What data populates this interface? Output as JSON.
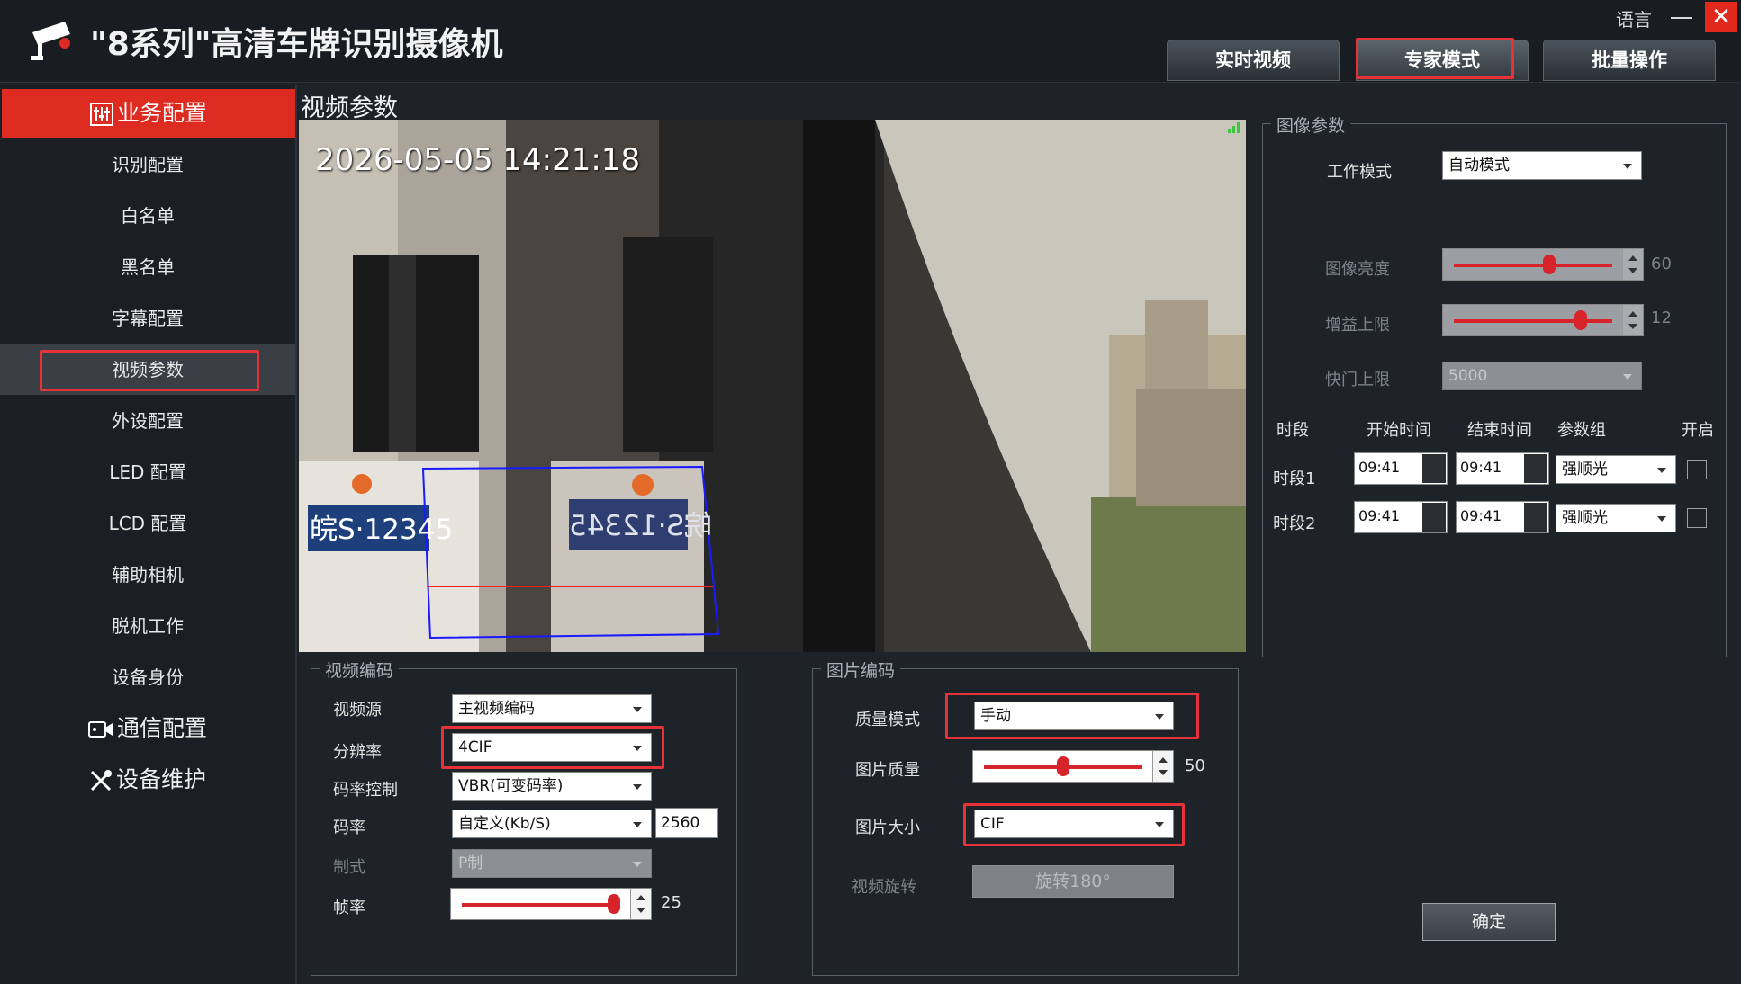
{
  "app": {
    "title": "\"8系列\"高清车牌识别摄像机",
    "language": "语言",
    "close_glyph": "✕"
  },
  "top_tabs": [
    {
      "label": "实时视频"
    },
    {
      "label": "专家模式"
    },
    {
      "label": "批量操作"
    }
  ],
  "sidebar": {
    "business_section": "业务配置",
    "items": [
      "识别配置",
      "白名单",
      "黑名单",
      "字幕配置",
      "视频参数",
      "外设配置",
      "LED 配置",
      "LCD 配置",
      "辅助相机",
      "脱机工作",
      "设备身份"
    ],
    "active_item": "视频参数",
    "comm_section": "通信配置",
    "maint_section": "设备维护"
  },
  "main": {
    "title": "视频参数",
    "video": {
      "timestamp": "2026-05-05 14:21:18",
      "plate_left": "皖S·12345",
      "plate_right": "皖S·12345"
    }
  },
  "video_encoding": {
    "legend": "视频编码",
    "source_label": "视频源",
    "source_value": "主视频编码",
    "resolution_label": "分辨率",
    "resolution_value": "4CIF",
    "rate_control_label": "码率控制",
    "rate_control_value": "VBR(可变码率)",
    "bitrate_label": "码率",
    "bitrate_value": "自定义(Kb/S)",
    "bitrate_number": "2560",
    "standard_label": "制式",
    "standard_value": "P制",
    "framerate_label": "帧率",
    "framerate_value": "25",
    "framerate_fraction": 0.96
  },
  "picture_encoding": {
    "legend": "图片编码",
    "quality_mode_label": "质量模式",
    "quality_mode_value": "手动",
    "quality_label": "图片质量",
    "quality_value": "50",
    "quality_fraction": 0.5,
    "size_label": "图片大小",
    "size_value": "CIF",
    "rotate_label": "视频旋转",
    "rotate_button": "旋转180°"
  },
  "image_params": {
    "legend": "图像参数",
    "work_mode_label": "工作模式",
    "work_mode_value": "自动模式",
    "brightness_label": "图像亮度",
    "brightness_value": "60",
    "brightness_fraction": 0.6,
    "gain_label": "增益上限",
    "gain_value": "12",
    "gain_fraction": 0.8,
    "shutter_label": "快门上限",
    "shutter_value": "5000",
    "schedule_headers": [
      "时段",
      "开始时间",
      "结束时间",
      "参数组",
      "开启"
    ],
    "schedules": [
      {
        "name": "时段1",
        "start": "09:41",
        "end": "09:41",
        "group": "强顺光",
        "enabled": false
      },
      {
        "name": "时段2",
        "start": "09:41",
        "end": "09:41",
        "group": "强顺光",
        "enabled": false
      }
    ]
  },
  "confirm_button": "确定",
  "colors": {
    "accent": "#dd2b22",
    "highlight": "#e8323a",
    "background": "#1e2329"
  }
}
